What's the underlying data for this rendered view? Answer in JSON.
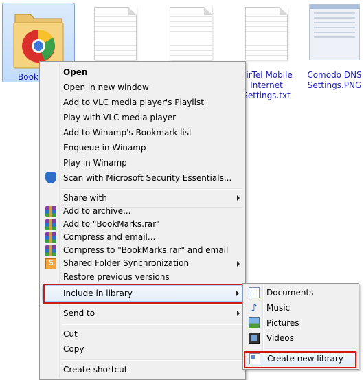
{
  "files": [
    {
      "label": "BookMarks",
      "type": "folder"
    },
    {
      "label": "",
      "type": "doc"
    },
    {
      "label": "",
      "type": "doc"
    },
    {
      "label": "AirTel Mobile Internet Settings.txt",
      "type": "doc"
    },
    {
      "label": "Comodo DNS Settings.PNG",
      "type": "image"
    }
  ],
  "context_menu": {
    "items": [
      {
        "label": "Open",
        "bold": true
      },
      {
        "label": "Open in new window"
      },
      {
        "label": "Add to VLC media player's Playlist"
      },
      {
        "label": "Play with VLC media player"
      },
      {
        "label": "Add to Winamp's Bookmark list"
      },
      {
        "label": "Enqueue in Winamp"
      },
      {
        "label": "Play in Winamp"
      },
      {
        "label": "Scan with Microsoft Security Essentials...",
        "icon": "security-essentials-icon"
      },
      {
        "label": "Share with",
        "submenu": true
      },
      {
        "label": "Add to archive...",
        "icon": "winrar-icon"
      },
      {
        "label": "Add to \"BookMarks.rar\"",
        "icon": "winrar-icon"
      },
      {
        "label": "Compress and email...",
        "icon": "winrar-icon"
      },
      {
        "label": "Compress to \"BookMarks.rar\" and email",
        "icon": "winrar-icon"
      },
      {
        "label": "Shared Folder Synchronization",
        "icon": "sync-icon",
        "submenu": true
      },
      {
        "label": "Restore previous versions"
      },
      {
        "label": "Include in library",
        "submenu": true,
        "highlighted": true
      },
      {
        "label": "Send to",
        "submenu": true
      },
      {
        "label": "Cut"
      },
      {
        "label": "Copy"
      },
      {
        "label": "Create shortcut"
      }
    ]
  },
  "library_submenu": {
    "items": [
      {
        "label": "Documents",
        "icon": "documents-library-icon"
      },
      {
        "label": "Music",
        "icon": "music-library-icon"
      },
      {
        "label": "Pictures",
        "icon": "pictures-library-icon"
      },
      {
        "label": "Videos",
        "icon": "videos-library-icon"
      },
      {
        "label": "Create new library",
        "icon": "new-library-icon",
        "highlighted": true
      }
    ]
  },
  "colors": {
    "highlight_box": "#d01818",
    "file_label": "#1a1ab3",
    "menu_bg": "#f0f0f0"
  }
}
